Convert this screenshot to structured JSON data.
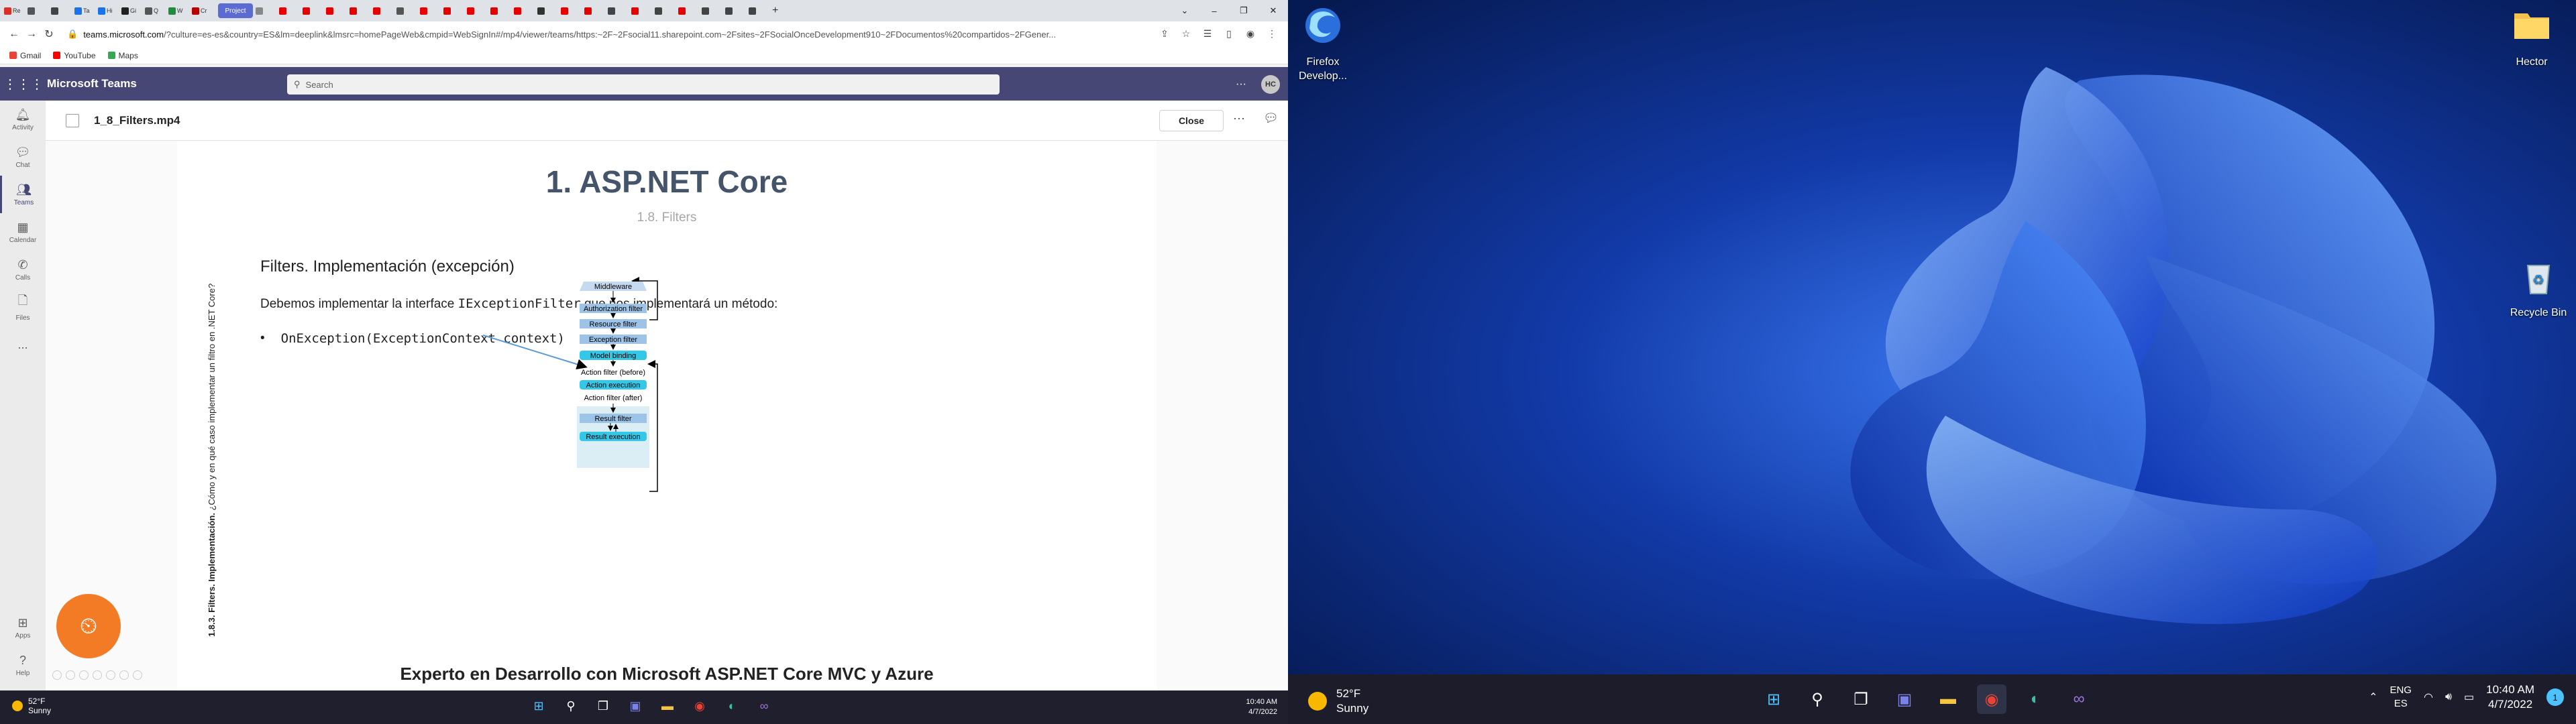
{
  "browser": {
    "tabs": [
      "Re",
      "",
      "",
      "Ta",
      "Hi",
      "",
      "",
      "Gi",
      "Q",
      "",
      "W",
      "",
      "Cr",
      "",
      "",
      "",
      "",
      "",
      "",
      "",
      "",
      "",
      "",
      "",
      "",
      "",
      "",
      "",
      "",
      "",
      "",
      "",
      "",
      "",
      "",
      "",
      "",
      "",
      "",
      ""
    ],
    "active_tab": "Project",
    "url_host": "teams.microsoft.com",
    "url_rest": "/?culture=es-es&country=ES&lm=deeplink&lmsrc=homePageWeb&cmpid=WebSignIn#/mp4/viewer/teams/https:~2F~2Fsocial11.sharepoint.com~2Fsites~2FSocialOnceDevelopment910~2FDocumentos%20compartidos~2FGener...",
    "bookmarks": [
      {
        "label": "Gmail",
        "color": "#ea4335"
      },
      {
        "label": "YouTube",
        "color": "#ff0000"
      },
      {
        "label": "Maps",
        "color": "#34a853"
      }
    ]
  },
  "teams": {
    "app_title": "Microsoft Teams",
    "search_placeholder": "Search",
    "avatar_initials": "HC",
    "rail": [
      {
        "label": "Activity",
        "icon": "bell-icon"
      },
      {
        "label": "Chat",
        "icon": "chat-icon"
      },
      {
        "label": "Teams",
        "icon": "teams-icon"
      },
      {
        "label": "Calendar",
        "icon": "calendar-icon"
      },
      {
        "label": "Calls",
        "icon": "phone-icon"
      },
      {
        "label": "Files",
        "icon": "file-icon"
      },
      {
        "label": "...",
        "icon": "more-icon"
      }
    ],
    "rail_bottom": [
      {
        "label": "Apps",
        "icon": "apps-icon"
      },
      {
        "label": "Help",
        "icon": "help-icon"
      }
    ],
    "file_name": "1_8_Filters.mp4",
    "close_label": "Close"
  },
  "slide": {
    "title": "1. ASP.NET Core",
    "subtitle": "1.8. Filters",
    "vertical_bold": "1.8.3. Filters. Implementación.",
    "vertical_text": " ¿Cómo y en qué caso implementar un filtro en .NET Core?",
    "section_title": "Filters. Implementación (excepción)",
    "text_before": "Debemos implementar la interface ",
    "text_code": "IExceptionFilter",
    "text_after": " que nos implementará un método:",
    "bullet_mark": "•",
    "bullet_code": "OnException(ExceptionContext context)",
    "footer": "Experto en Desarrollo con Microsoft ASP.NET Core MVC y Azure",
    "pipeline": [
      "Middleware",
      "Authorization filter",
      "Resource filter",
      "Exception filter",
      "Model binding",
      "Action filter (before)",
      "Action execution",
      "Action filter (after)",
      "Result filter",
      "Result execution"
    ]
  },
  "taskbar_small": {
    "temp": "52°F",
    "condition": "Sunny",
    "time": "10:40 AM",
    "date": "4/7/2022"
  },
  "desktop": {
    "icons": [
      {
        "label1": "Firefox",
        "label2": "Develop..."
      },
      {
        "label1": "Hector",
        "label2": ""
      },
      {
        "label1": "Recycle Bin",
        "label2": ""
      }
    ]
  },
  "taskbar": {
    "temp": "52°F",
    "condition": "Sunny",
    "lang1": "ENG",
    "lang2": "ES",
    "time": "10:40 AM",
    "date": "4/7/2022",
    "notification_count": "1"
  },
  "colors": {
    "teams_purple": "#464775",
    "pipeline_light": "#9dc3e6",
    "pipeline_cyan": "#34c8e8",
    "orange": "#f47b26"
  }
}
